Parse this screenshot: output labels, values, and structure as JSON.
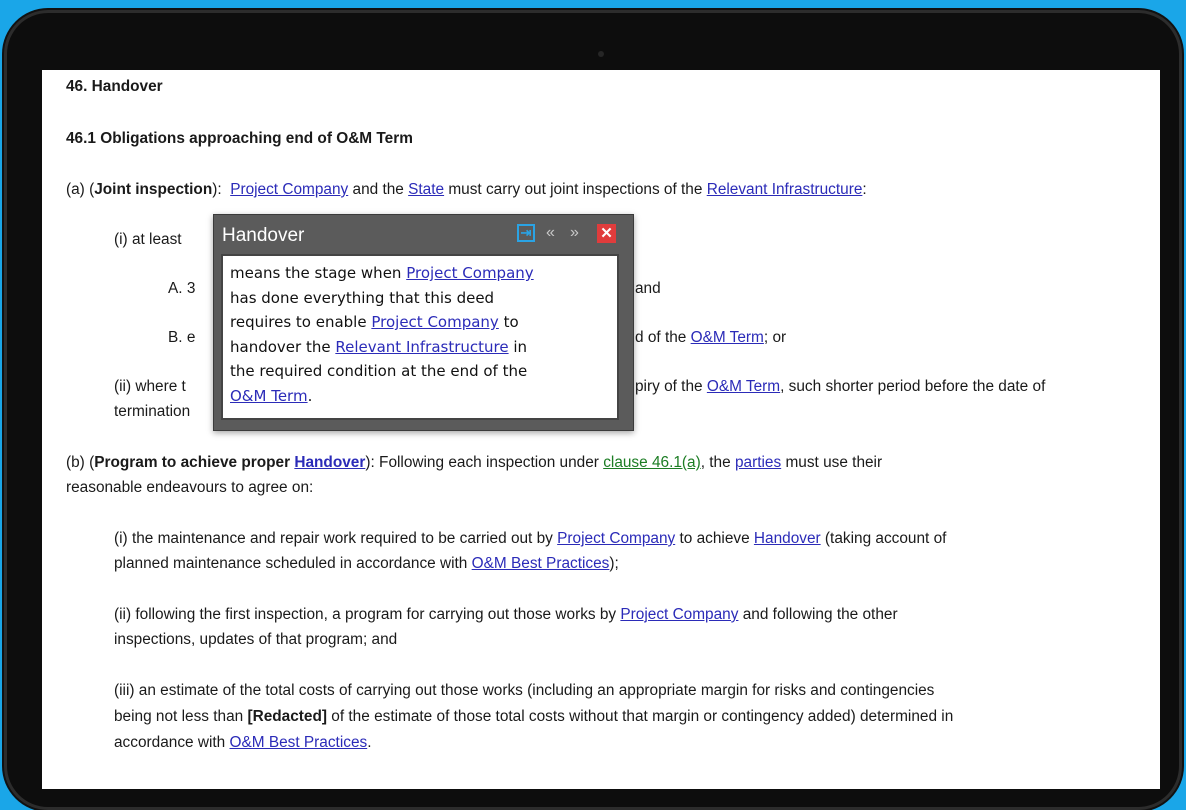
{
  "doc": {
    "h1": "46. Handover",
    "h2": "46.1 Obligations approaching end of O&M Term",
    "a": {
      "prefix": "(a) (",
      "bold": "Joint inspection",
      "after_bold": "):",
      "link1": "Project Company",
      "mid1": " and the ",
      "link2": "State",
      "mid2": " must carry out joint inspections of the ",
      "link3": "Relevant Infrastructure",
      "suffix": ":"
    },
    "a_i": "(i) at least",
    "a_A_prefix": "A. 3",
    "a_A_tail": "and",
    "a_B_prefix": "B. e",
    "a_B_tail_pre": "d of the ",
    "a_B_link": "O&M Term",
    "a_B_tail_post": "; or",
    "a_ii_prefix": "(ii) where t",
    "a_ii_tail_pre": "piry of the ",
    "a_ii_link": "O&M Term",
    "a_ii_tail_post": ", such shorter period before the date of",
    "a_ii_line2": "termination",
    "b": {
      "prefix": "(b) (",
      "bold": "Program to achieve proper ",
      "bold_link": "Handover",
      "after_bold": "):  Following each inspection under ",
      "clause_link": "clause 46.1(a)",
      "mid": ", the ",
      "parties_link": "parties",
      "suffix": " must use their",
      "line2": "reasonable endeavours to agree on:"
    },
    "b_i": {
      "pre": "(i)  the maintenance and repair work required to be carried out by ",
      "link1": "Project Company",
      "mid": " to achieve ",
      "link2": "Handover",
      "post": " (taking account of",
      "line2_pre": "planned maintenance scheduled in accordance with ",
      "line2_link": "O&M Best Practices",
      "line2_post": ");"
    },
    "b_ii": {
      "pre": "(ii)  following the first inspection, a program for carrying out those works by ",
      "link": "Project Company",
      "post": " and following the other",
      "line2": "inspections, updates of that program; and"
    },
    "b_iii": {
      "line1": "(iii)  an estimate of the total costs of carrying out those works (including an appropriate margin for risks and contingencies",
      "line2_pre": "being not less than ",
      "line2_bold": "[Redacted]",
      "line2_post": " of the estimate of those total costs without that margin or contingency added) determined in",
      "line3_pre": "accordance with ",
      "line3_link": "O&M Best Practices",
      "line3_post": "."
    }
  },
  "popup": {
    "title": "Handover",
    "line1_pre": "means the stage when ",
    "line1_link": "Project Company",
    "line2": "has done everything that this deed",
    "line3_pre": "requires to enable ",
    "line3_link": "Project Company",
    "line3_post": " to",
    "line4_pre": "handover the ",
    "line4_link": "Relevant Infrastructure",
    "line4_post": " in",
    "line5": "the required condition at the end of the",
    "line6_link": "O&M Term",
    "line6_post": ".",
    "icons": {
      "pin": "pin-to-panel-icon",
      "prev": "previous-icon",
      "next": "next-icon",
      "close": "close-icon"
    },
    "glyphs": {
      "pin": "⇥",
      "prev": "«",
      "next": "»",
      "close": "✕"
    }
  }
}
